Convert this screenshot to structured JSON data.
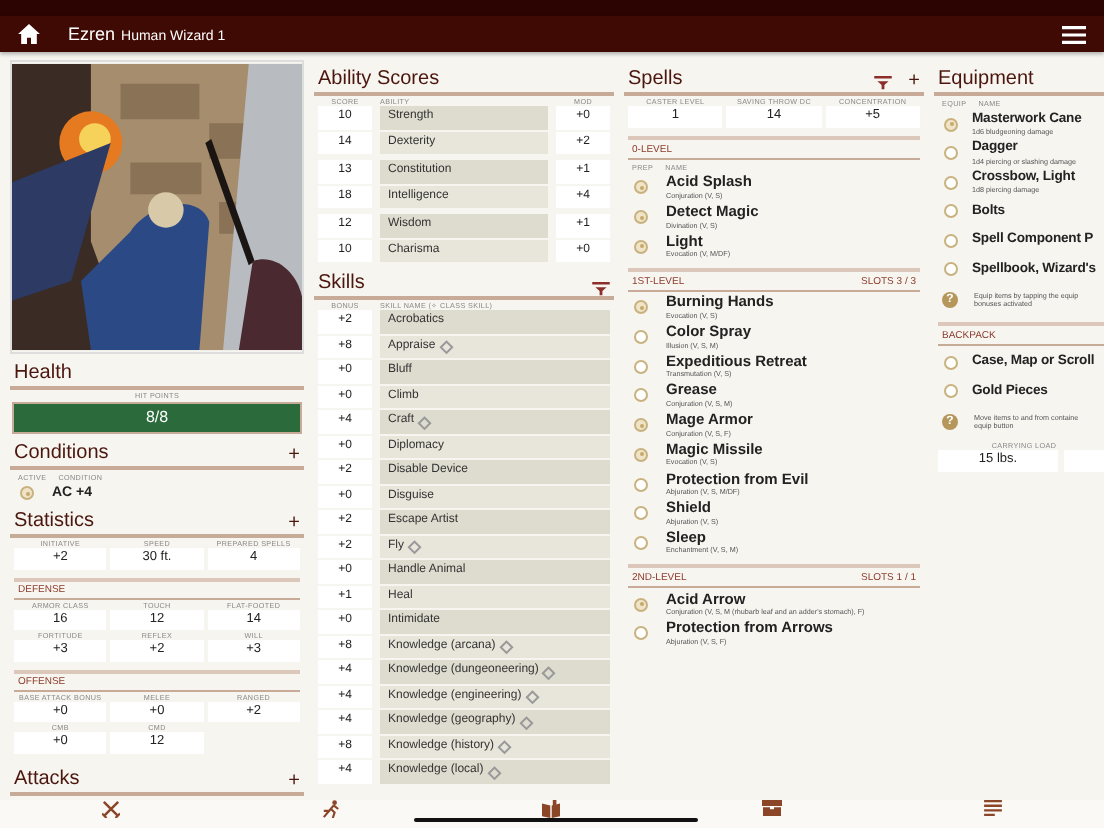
{
  "header": {
    "name": "Ezren",
    "subtitle": "Human Wizard 1"
  },
  "health": {
    "title": "Health",
    "label": "HIT POINTS",
    "value": "8/8",
    "level": 1
  },
  "conditions": {
    "title": "Conditions",
    "add": "+",
    "columns": [
      "ACTIVE",
      "CONDITION"
    ],
    "items": [
      {
        "name": "AC +4",
        "active": true
      }
    ]
  },
  "statistics": {
    "title": "Statistics",
    "add": "+",
    "main": [
      {
        "label": "INITIATIVE",
        "value": "+2"
      },
      {
        "label": "SPEED",
        "value": "30 ft."
      },
      {
        "label": "PREPARED SPELLS",
        "value": "4"
      }
    ],
    "sections": [
      {
        "title": "DEFENSE",
        "rows": [
          [
            {
              "label": "ARMOR CLASS",
              "value": "16"
            },
            {
              "label": "TOUCH",
              "value": "12"
            },
            {
              "label": "FLAT-FOOTED",
              "value": "14"
            }
          ],
          [
            {
              "label": "FORTITUDE",
              "value": "+3"
            },
            {
              "label": "REFLEX",
              "value": "+2"
            },
            {
              "label": "WILL",
              "value": "+3"
            }
          ]
        ]
      },
      {
        "title": "OFFENSE",
        "rows": [
          [
            {
              "label": "BASE ATTACK BONUS",
              "value": "+0"
            },
            {
              "label": "MELEE",
              "value": "+0"
            },
            {
              "label": "RANGED",
              "value": "+2"
            }
          ],
          [
            {
              "label": "CMB",
              "value": "+0"
            },
            {
              "label": "CMD",
              "value": "12"
            }
          ]
        ]
      }
    ]
  },
  "attacks": {
    "title": "Attacks",
    "add": "+"
  },
  "abilities": {
    "title": "Ability Scores",
    "columns": [
      "SCORE",
      "ABILITY",
      "MOD"
    ],
    "rows": [
      {
        "score": "10",
        "name": "Strength",
        "mod": "+0"
      },
      {
        "score": "14",
        "name": "Dexterity",
        "mod": "+2"
      },
      {
        "score": "13",
        "name": "Constitution",
        "mod": "+1"
      },
      {
        "score": "18",
        "name": "Intelligence",
        "mod": "+4"
      },
      {
        "score": "12",
        "name": "Wisdom",
        "mod": "+1"
      },
      {
        "score": "10",
        "name": "Charisma",
        "mod": "+0"
      }
    ]
  },
  "skills": {
    "title": "Skills",
    "columns": [
      "BONUS",
      "SKILL NAME (✧ CLASS SKILL)"
    ],
    "rows": [
      {
        "bonus": "+2",
        "name": "Acrobatics",
        "class_skill": false
      },
      {
        "bonus": "+8",
        "name": "Appraise",
        "class_skill": true
      },
      {
        "bonus": "+0",
        "name": "Bluff",
        "class_skill": false
      },
      {
        "bonus": "+0",
        "name": "Climb",
        "class_skill": false
      },
      {
        "bonus": "+4",
        "name": "Craft",
        "class_skill": true
      },
      {
        "bonus": "+0",
        "name": "Diplomacy",
        "class_skill": false
      },
      {
        "bonus": "+2",
        "name": "Disable Device",
        "class_skill": false
      },
      {
        "bonus": "+0",
        "name": "Disguise",
        "class_skill": false
      },
      {
        "bonus": "+2",
        "name": "Escape Artist",
        "class_skill": false
      },
      {
        "bonus": "+2",
        "name": "Fly",
        "class_skill": true
      },
      {
        "bonus": "+0",
        "name": "Handle Animal",
        "class_skill": false
      },
      {
        "bonus": "+1",
        "name": "Heal",
        "class_skill": false
      },
      {
        "bonus": "+0",
        "name": "Intimidate",
        "class_skill": false
      },
      {
        "bonus": "+8",
        "name": "Knowledge (arcana)",
        "class_skill": true
      },
      {
        "bonus": "+4",
        "name": "Knowledge (dungeoneering)",
        "class_skill": true
      },
      {
        "bonus": "+4",
        "name": "Knowledge (engineering)",
        "class_skill": true
      },
      {
        "bonus": "+4",
        "name": "Knowledge (geography)",
        "class_skill": true
      },
      {
        "bonus": "+8",
        "name": "Knowledge (history)",
        "class_skill": true
      },
      {
        "bonus": "+4",
        "name": "Knowledge (local)",
        "class_skill": true
      }
    ]
  },
  "spells": {
    "title": "Spells",
    "add": "+",
    "stats": [
      {
        "label": "CASTER LEVEL",
        "value": "1"
      },
      {
        "label": "SAVING THROW DC",
        "value": "14"
      },
      {
        "label": "CONCENTRATION",
        "value": "+5"
      }
    ],
    "levels": [
      {
        "title": "0-LEVEL",
        "columns": [
          "PREP",
          "NAME"
        ],
        "spells": [
          {
            "name": "Acid Splash",
            "detail": "Conjuration (V, S)",
            "prepared": true
          },
          {
            "name": "Detect Magic",
            "detail": "Divination (V, S)",
            "prepared": true
          },
          {
            "name": "Light",
            "detail": "Evocation (V, M/DF)",
            "prepared": true
          }
        ]
      },
      {
        "title": "1ST-LEVEL",
        "slots": "SLOTS 3 / 3",
        "spells": [
          {
            "name": "Burning Hands",
            "detail": "Evocation (V, S)",
            "prepared": true
          },
          {
            "name": "Color Spray",
            "detail": "Illusion (V, S, M)",
            "prepared": false
          },
          {
            "name": "Expeditious Retreat",
            "detail": "Transmutation (V, S)",
            "prepared": false
          },
          {
            "name": "Grease",
            "detail": "Conjuration (V, S, M)",
            "prepared": false
          },
          {
            "name": "Mage Armor",
            "detail": "Conjuration (V, S, F)",
            "prepared": true
          },
          {
            "name": "Magic Missile",
            "detail": "Evocation (V, S)",
            "prepared": true
          },
          {
            "name": "Protection from Evil",
            "detail": "Abjuration (V, S, M/DF)",
            "prepared": false
          },
          {
            "name": "Shield",
            "detail": "Abjuration (V, S)",
            "prepared": false
          },
          {
            "name": "Sleep",
            "detail": "Enchantment (V, S, M)",
            "prepared": false
          }
        ]
      },
      {
        "title": "2ND-LEVEL",
        "slots": "SLOTS 1 / 1",
        "spells": [
          {
            "name": "Acid Arrow",
            "detail": "Conjuration (V, S, M (rhubarb leaf and an adder's stomach), F)",
            "prepared": true
          },
          {
            "name": "Protection from Arrows",
            "detail": "Abjuration (V, S, F)",
            "prepared": false
          }
        ]
      }
    ]
  },
  "equipment": {
    "title": "Equipment",
    "columns": [
      "EQUIP",
      "NAME"
    ],
    "items": [
      {
        "name": "Masterwork Cane",
        "detail": "1d6 bludgeoning damage",
        "equipped": true
      },
      {
        "name": "Dagger",
        "detail": "1d4 piercing or slashing damage",
        "equipped": false
      },
      {
        "name": "Crossbow, Light",
        "detail": "1d8 piercing damage",
        "equipped": false
      },
      {
        "name": "Bolts",
        "equipped": false
      },
      {
        "name": "Spell Component P",
        "equipped": false
      },
      {
        "name": "Spellbook, Wizard's",
        "equipped": false
      }
    ],
    "help": {
      "icon": "?",
      "lines": [
        "Equip items by tapping the equip",
        "bonuses activated"
      ]
    },
    "backpack": {
      "title": "BACKPACK",
      "items": [
        {
          "name": "Case, Map or Scroll",
          "equipped": false
        },
        {
          "name": "Gold Pieces",
          "equipped": false
        }
      ],
      "help": {
        "icon": "?",
        "lines": [
          "Move items to and from containe",
          "equip button"
        ]
      },
      "load": {
        "label": "CARRYING LOAD",
        "value": "15 lbs."
      }
    }
  }
}
